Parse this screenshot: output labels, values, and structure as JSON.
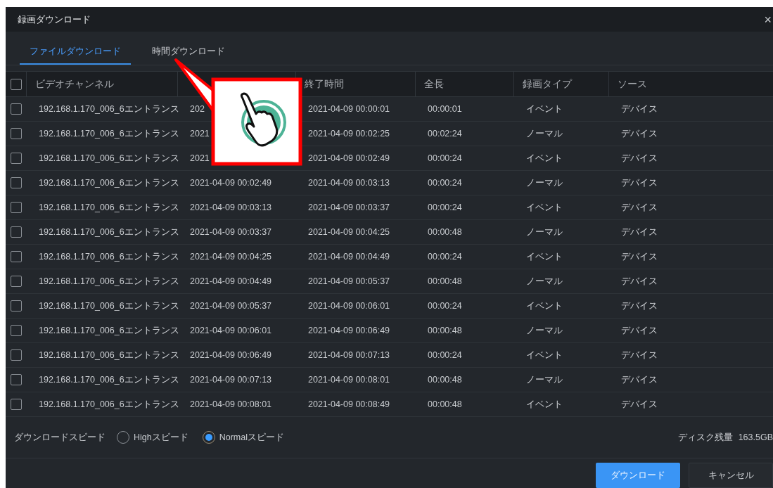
{
  "window": {
    "title": "録画ダウンロード",
    "close": "×"
  },
  "tabs": [
    {
      "label": "ファイルダウンロード",
      "selected": true
    },
    {
      "label": "時間ダウンロード",
      "selected": false
    }
  ],
  "table": {
    "header_checked": false,
    "columns": [
      {
        "kind": "text",
        "label": "ビデオチャンネル"
      },
      {
        "kind": "covered"
      },
      {
        "kind": "text",
        "label": "終了時間"
      },
      {
        "kind": "text",
        "label": "全長"
      },
      {
        "kind": "text",
        "label": "録画タイプ"
      },
      {
        "kind": "text",
        "label": "ソース"
      }
    ],
    "rows": [
      {
        "checked": false,
        "cells": [
          "192.168.1.170_006_6エントランス",
          "202",
          "2021-04-09 00:00:01",
          "00:00:01",
          "イベント",
          "デバイス"
        ]
      },
      {
        "checked": false,
        "cells": [
          "192.168.1.170_006_6エントランス",
          "2021",
          "2021-04-09 00:02:25",
          "00:02:24",
          "ノーマル",
          "デバイス"
        ]
      },
      {
        "checked": false,
        "cells": [
          "192.168.1.170_006_6エントランス",
          "2021",
          "2021-04-09 00:02:49",
          "00:00:24",
          "イベント",
          "デバイス"
        ]
      },
      {
        "checked": false,
        "cells": [
          "192.168.1.170_006_6エントランス",
          "2021-04-09 00:02:49",
          "2021-04-09 00:03:13",
          "00:00:24",
          "ノーマル",
          "デバイス"
        ]
      },
      {
        "checked": false,
        "cells": [
          "192.168.1.170_006_6エントランス",
          "2021-04-09 00:03:13",
          "2021-04-09 00:03:37",
          "00:00:24",
          "イベント",
          "デバイス"
        ]
      },
      {
        "checked": false,
        "cells": [
          "192.168.1.170_006_6エントランス",
          "2021-04-09 00:03:37",
          "2021-04-09 00:04:25",
          "00:00:48",
          "ノーマル",
          "デバイス"
        ]
      },
      {
        "checked": false,
        "cells": [
          "192.168.1.170_006_6エントランス",
          "2021-04-09 00:04:25",
          "2021-04-09 00:04:49",
          "00:00:24",
          "イベント",
          "デバイス"
        ]
      },
      {
        "checked": false,
        "cells": [
          "192.168.1.170_006_6エントランス",
          "2021-04-09 00:04:49",
          "2021-04-09 00:05:37",
          "00:00:48",
          "ノーマル",
          "デバイス"
        ]
      },
      {
        "checked": false,
        "cells": [
          "192.168.1.170_006_6エントランス",
          "2021-04-09 00:05:37",
          "2021-04-09 00:06:01",
          "00:00:24",
          "イベント",
          "デバイス"
        ]
      },
      {
        "checked": false,
        "cells": [
          "192.168.1.170_006_6エントランス",
          "2021-04-09 00:06:01",
          "2021-04-09 00:06:49",
          "00:00:48",
          "ノーマル",
          "デバイス"
        ]
      },
      {
        "checked": false,
        "cells": [
          "192.168.1.170_006_6エントランス",
          "2021-04-09 00:06:49",
          "2021-04-09 00:07:13",
          "00:00:24",
          "イベント",
          "デバイス"
        ]
      },
      {
        "checked": false,
        "cells": [
          "192.168.1.170_006_6エントランス",
          "2021-04-09 00:07:13",
          "2021-04-09 00:08:01",
          "00:00:48",
          "ノーマル",
          "デバイス"
        ]
      },
      {
        "checked": false,
        "cells": [
          "192.168.1.170_006_6エントランス",
          "2021-04-09 00:08:01",
          "2021-04-09 00:08:49",
          "00:00:48",
          "イベント",
          "デバイス"
        ]
      }
    ]
  },
  "speed": {
    "label": "ダウンロードスピード",
    "options": [
      {
        "label": "Highスピード",
        "selected": false
      },
      {
        "label": "Normalスピード",
        "selected": true
      }
    ]
  },
  "disk": {
    "label": "ディスク残量",
    "value": "163.5GB"
  },
  "buttons": [
    {
      "label": "ダウンロード",
      "kind": "primary"
    },
    {
      "label": "キャンセル",
      "kind": "secondary"
    }
  ]
}
